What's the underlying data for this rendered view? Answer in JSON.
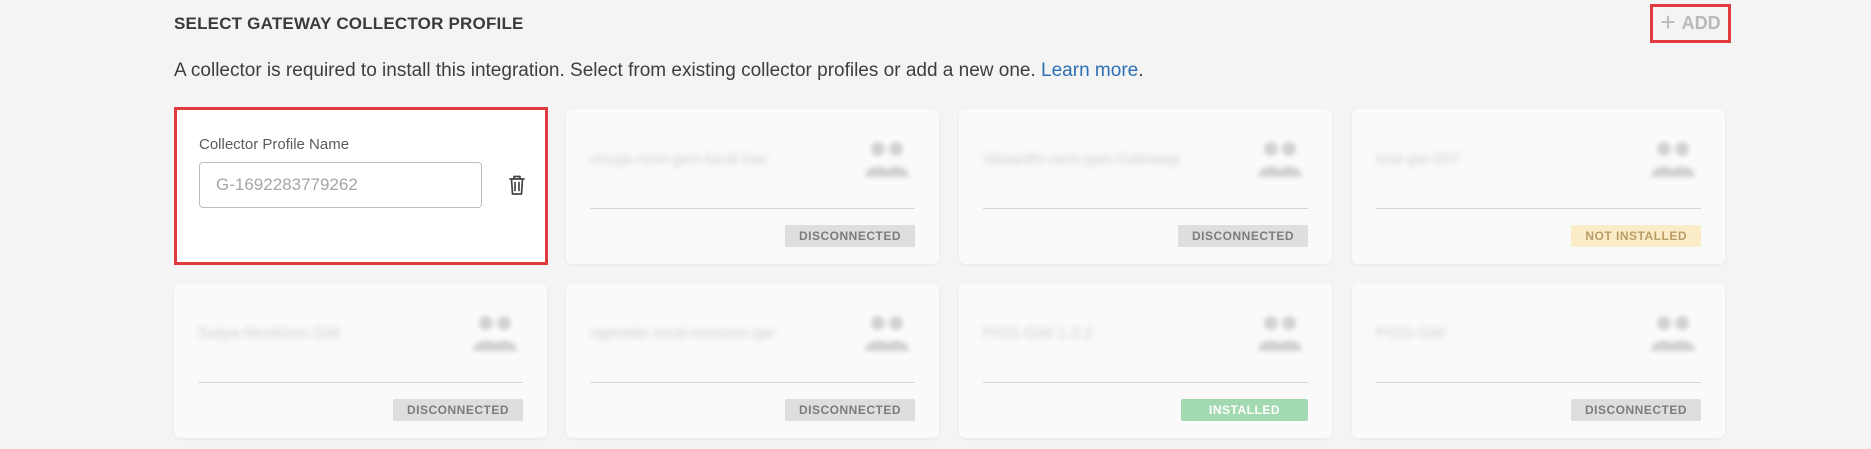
{
  "section": {
    "title": "SELECT GATEWAY COLLECTOR PROFILE",
    "add_label": "ADD",
    "description_prefix": "A collector is required to install this integration. Select from existing collector profiles or add a new one. ",
    "learn_more": "Learn more",
    "description_suffix": "."
  },
  "new_profile": {
    "label": "Collector Profile Name",
    "placeholder": "G-1692283779262"
  },
  "profiles": [
    {
      "name": "vinuja-next-gen-local-low",
      "status": "DISCONNECTED"
    },
    {
      "name": "Vasanthi-next-gen-Gateway",
      "status": "DISCONNECTED"
    },
    {
      "name": "test-gw-207",
      "status": "NOT INSTALLED"
    },
    {
      "name": "Satya-NextGen-GW",
      "status": "DISCONNECTED"
    },
    {
      "name": "rajendar-local-nextzen-gw",
      "status": "DISCONNECTED"
    },
    {
      "name": "PISS-GW-1.2.2",
      "status": "INSTALLED"
    },
    {
      "name": "PISS-GW",
      "status": "DISCONNECTED"
    }
  ],
  "colors": {
    "highlight": "#e0393e",
    "link": "#2c6fb3",
    "installed": "#a3d9b1",
    "not_installed": "#fbecc8",
    "disconnected": "#dedede"
  }
}
